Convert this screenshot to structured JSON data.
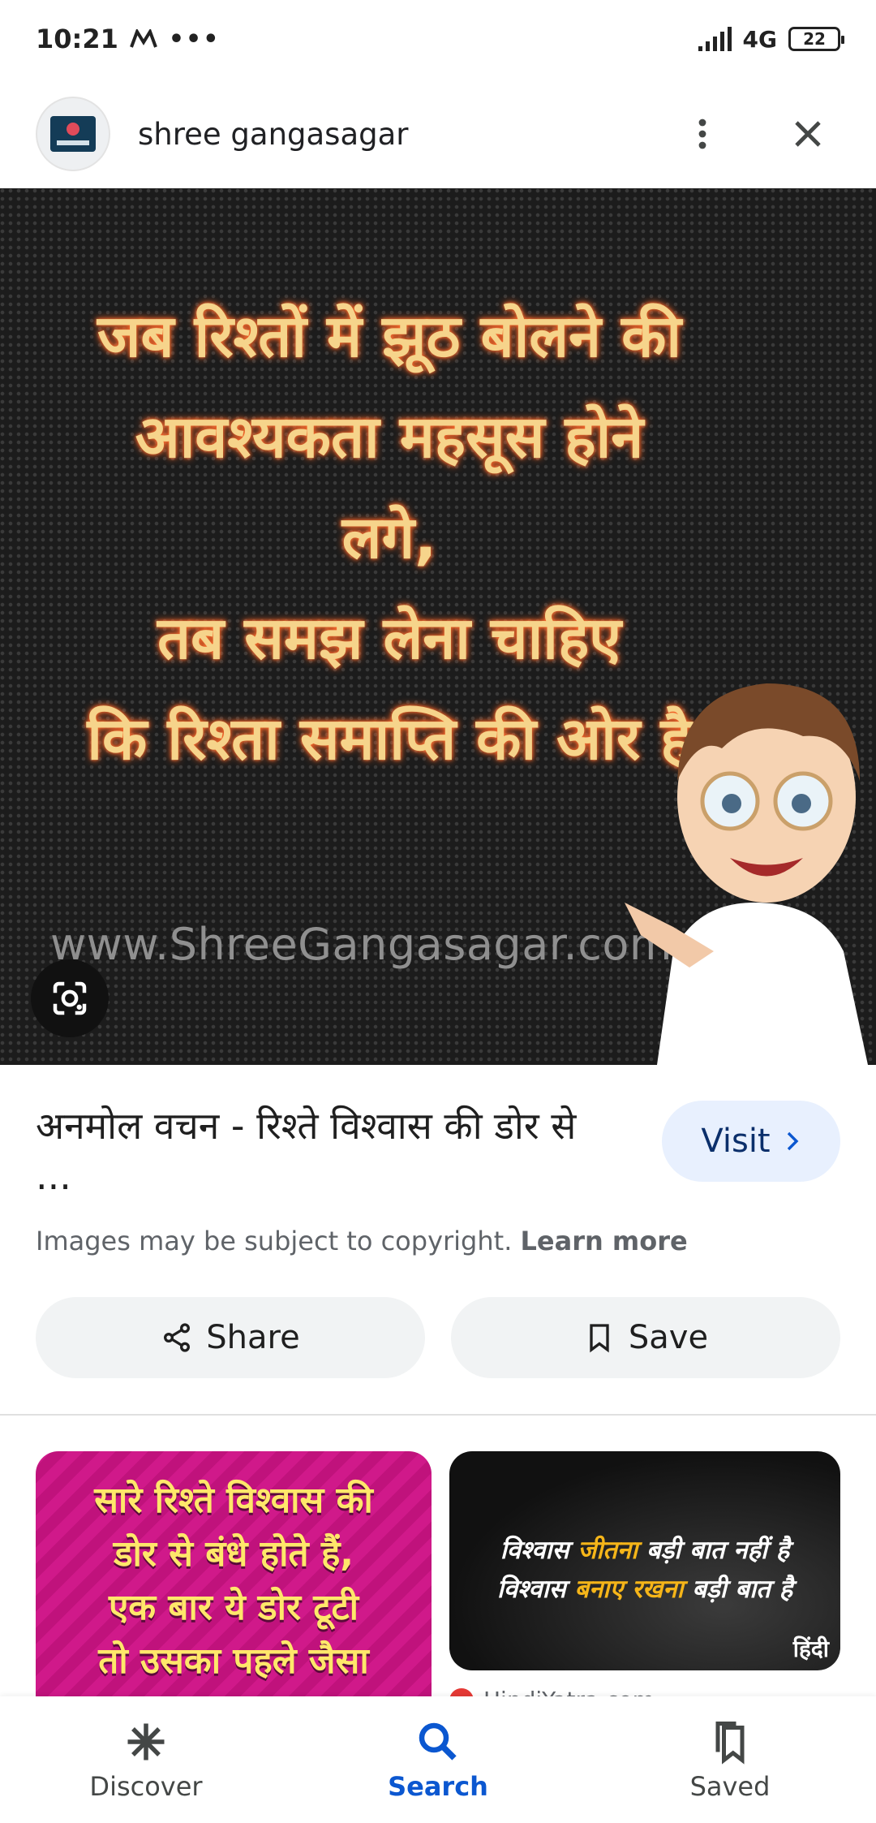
{
  "status_bar": {
    "time": "10:21",
    "network": "4G",
    "battery": "22"
  },
  "header": {
    "site_name": "shree gangasagar"
  },
  "main_image": {
    "quote_lines": [
      "जब रिश्तों में झूठ बोलने की",
      "आवश्यकता महसूस होने",
      "लगे,",
      "तब समझ लेना चाहिए",
      "कि रिश्ता समाप्ति की ओर है"
    ],
    "watermark": "www.ShreeGangasagar.com"
  },
  "result": {
    "title": "अनमोल वचन - रिश्ते विश्वास की डोर से ...",
    "visit_label": "Visit",
    "copyright_text": "Images may be subject to copyright.",
    "learn_more": "Learn more",
    "share_label": "Share",
    "save_label": "Save"
  },
  "related": [
    {
      "lines": [
        "सारे रिश्ते विश्वास की",
        "डोर से बंधे होते हैं,",
        "एक बार ये डोर टूटी",
        "तो उसका पहले जैसा"
      ]
    },
    {
      "line1_a": "विश्वास ",
      "line1_b": "जीतना",
      "line1_c": " बड़ी बात नहीं है",
      "line2_a": "विश्वास ",
      "line2_b": "बनाए रखना",
      "line2_c": " बड़ी बात है",
      "brand": "हिंदी",
      "source": "HindiYatra.com"
    }
  ],
  "bottom_nav": [
    {
      "label": "Discover",
      "icon": "asterisk-icon"
    },
    {
      "label": "Search",
      "icon": "search-icon",
      "active": true
    },
    {
      "label": "Saved",
      "icon": "bookmarks-icon"
    }
  ],
  "colors": {
    "accent": "#0b57d0",
    "visit_bg": "#e8f0fe",
    "quote": "#f6d48b"
  }
}
